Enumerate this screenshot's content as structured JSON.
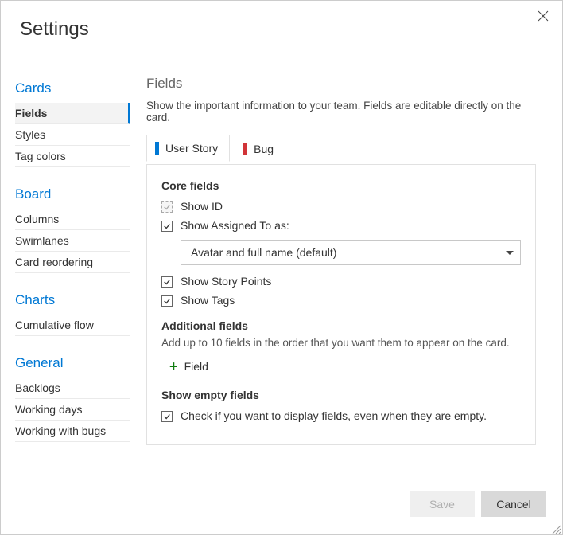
{
  "dialog": {
    "title": "Settings"
  },
  "sidebar": {
    "sections": [
      {
        "header": "Cards",
        "items": [
          "Fields",
          "Styles",
          "Tag colors"
        ],
        "selected": 0
      },
      {
        "header": "Board",
        "items": [
          "Columns",
          "Swimlanes",
          "Card reordering"
        ]
      },
      {
        "header": "Charts",
        "items": [
          "Cumulative flow"
        ]
      },
      {
        "header": "General",
        "items": [
          "Backlogs",
          "Working days",
          "Working with bugs"
        ]
      }
    ]
  },
  "main": {
    "title": "Fields",
    "desc": "Show the important information to your team. Fields are editable directly on the card.",
    "tabs": [
      "User Story",
      "Bug"
    ],
    "core": {
      "heading": "Core fields",
      "show_id": "Show ID",
      "show_assigned_to": "Show Assigned To as:",
      "assigned_to_value": "Avatar and full name (default)",
      "show_story_points": "Show Story Points",
      "show_tags": "Show Tags"
    },
    "additional": {
      "heading": "Additional fields",
      "note": "Add up to 10 fields in the order that you want them to appear on the card.",
      "add_label": "Field"
    },
    "empty": {
      "heading": "Show empty fields",
      "check_label": "Check if you want to display fields, even when they are empty."
    }
  },
  "footer": {
    "save": "Save",
    "cancel": "Cancel"
  }
}
